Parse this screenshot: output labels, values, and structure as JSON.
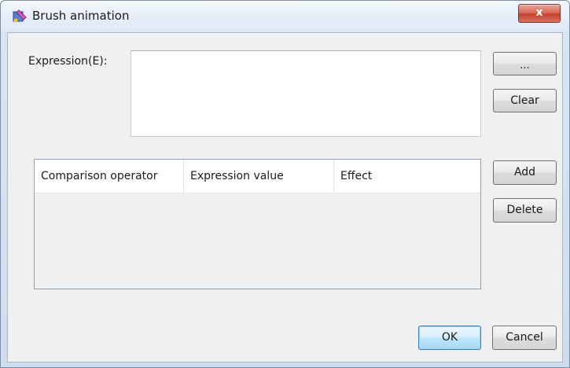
{
  "window": {
    "title": "Brush animation",
    "close_label": "x"
  },
  "expression": {
    "label": "Expression(E):",
    "value": "",
    "browse_label": "...",
    "clear_label": "Clear"
  },
  "table": {
    "columns": [
      "Comparison operator",
      "Expression value",
      "Effect"
    ],
    "rows": []
  },
  "side_buttons": {
    "add_label": "Add",
    "delete_label": "Delete"
  },
  "footer": {
    "ok_label": "OK",
    "cancel_label": "Cancel"
  },
  "colors": {
    "close_button": "#c4412f",
    "default_button_border": "#3c7fb1",
    "dialog_background": "#f0f0f0"
  }
}
